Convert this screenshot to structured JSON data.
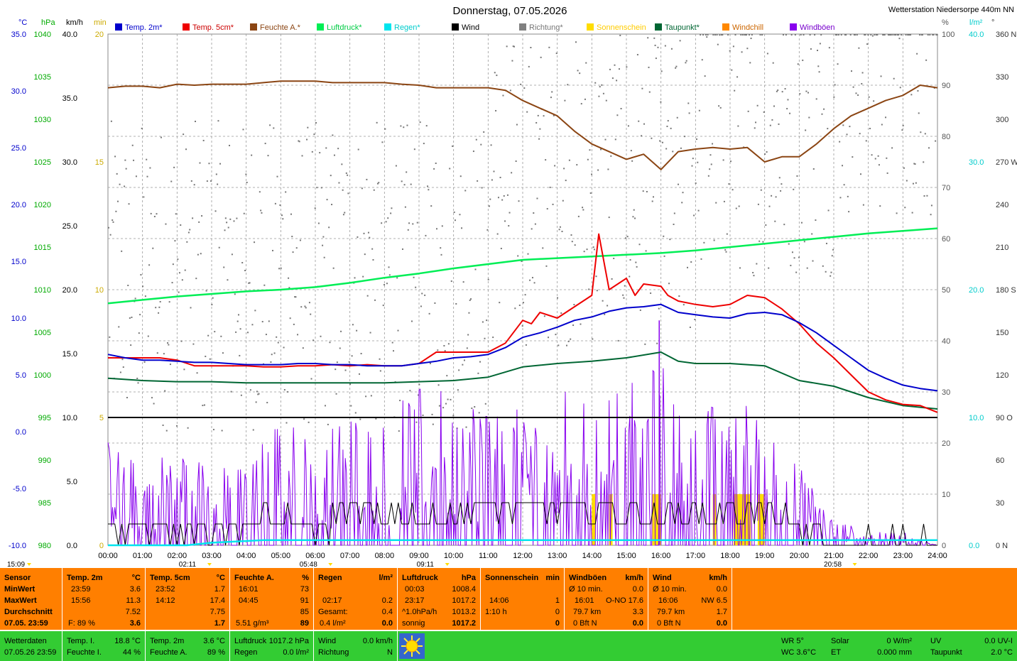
{
  "chart_data": {
    "type": "line",
    "title": "Donnerstag, 07.05.2026",
    "station": "Wetterstation Niedersorpe 440m NN",
    "x_ticks": [
      "00:00",
      "01:00",
      "02:00",
      "03:00",
      "04:00",
      "05:00",
      "06:00",
      "07:00",
      "08:00",
      "09:00",
      "10:00",
      "11:00",
      "12:00",
      "13:00",
      "14:00",
      "15:00",
      "16:00",
      "17:00",
      "18:00",
      "19:00",
      "20:00",
      "21:00",
      "22:00",
      "23:00",
      "24:00"
    ],
    "axes": {
      "temp_c": {
        "unit": "°C",
        "ylim": [
          -10,
          35
        ],
        "ticks": [
          "35.0",
          "30.0",
          "25.0",
          "20.0",
          "15.0",
          "10.0",
          "5.0",
          "0.0",
          "-5.0",
          "-10.0"
        ],
        "color": "#0000cc"
      },
      "pressure_hpa": {
        "unit": "hPa",
        "ylim": [
          980,
          1040
        ],
        "ticks": [
          "1040",
          "1035",
          "1030",
          "1025",
          "1020",
          "1015",
          "1010",
          "1005",
          "1000",
          "995",
          "990",
          "985",
          "980"
        ],
        "color": "#00aa00"
      },
      "wind_kmh": {
        "unit": "km/h",
        "ylim": [
          0,
          40
        ],
        "ticks": [
          "40.0",
          "35.0",
          "30.0",
          "25.0",
          "20.0",
          "15.0",
          "10.0",
          "5.0",
          "0.0"
        ],
        "color": "#000000"
      },
      "sun_min": {
        "unit": "min",
        "ylim": [
          0,
          20
        ],
        "ticks": [
          "20",
          "15",
          "10",
          "5",
          "0"
        ],
        "color": "#ccaa00"
      },
      "humidity_pct": {
        "unit": "%",
        "ylim": [
          0,
          100
        ],
        "ticks": [
          "100",
          "90",
          "80",
          "70",
          "60",
          "50",
          "40",
          "30",
          "20",
          "10",
          "0"
        ],
        "color": "#555555"
      },
      "rain_lm2": {
        "unit": "l/m²",
        "ylim": [
          0,
          40
        ],
        "ticks": [
          "40.0",
          "30.0",
          "20.0",
          "10.0",
          "0.0"
        ],
        "color": "#00cccc"
      },
      "direction_deg": {
        "unit": "°",
        "ylim": [
          0,
          360
        ],
        "ticks": [
          "360 N",
          "330",
          "300",
          "270 W",
          "240",
          "210",
          "180 S",
          "150",
          "120",
          "90 O",
          "60",
          "30",
          "0 N"
        ],
        "color": "#333333"
      }
    },
    "legend": [
      {
        "name": "Temp. 2m*",
        "color": "#0000cc"
      },
      {
        "name": "Temp. 5cm*",
        "color": "#ee0000"
      },
      {
        "name": "Feuchte A.*",
        "color": "#8b4513"
      },
      {
        "name": "Luftdruck*",
        "color": "#00ee55"
      },
      {
        "name": "Regen*",
        "color": "#00e5ee"
      },
      {
        "name": "Wind",
        "color": "#000000"
      },
      {
        "name": "Richtung*",
        "color": "#808080"
      },
      {
        "name": "Sonnenschein",
        "color": "#ffdd00"
      },
      {
        "name": "Taupunkt*",
        "color": "#006633"
      },
      {
        "name": "Windchill",
        "color": "#ff8800"
      },
      {
        "name": "Windböen",
        "color": "#8800ee"
      }
    ],
    "series": [
      {
        "name": "Temp. 2m*",
        "axis": "temp_c",
        "x": [
          0,
          0.5,
          1,
          1.5,
          2,
          2.5,
          3,
          3.5,
          4,
          4.5,
          5,
          5.5,
          6,
          6.5,
          7,
          7.5,
          8,
          8.5,
          9,
          9.5,
          10,
          10.5,
          11,
          11.5,
          12,
          12.5,
          13,
          13.5,
          14,
          14.5,
          15,
          15.5,
          16,
          16.5,
          17,
          17.5,
          18,
          18.5,
          19,
          19.5,
          20,
          20.5,
          21,
          21.5,
          22,
          22.5,
          23,
          23.5,
          24
        ],
        "y": [
          6.8,
          6.5,
          6.3,
          6.3,
          6.2,
          6.1,
          6.1,
          6.0,
          5.9,
          5.9,
          5.9,
          6.0,
          6.0,
          5.9,
          5.9,
          5.8,
          5.8,
          5.8,
          6.0,
          6.2,
          6.5,
          6.6,
          6.8,
          7.4,
          8.3,
          8.7,
          9.2,
          9.8,
          10.1,
          10.6,
          10.9,
          11.0,
          11.2,
          10.5,
          10.3,
          10.1,
          10.0,
          10.4,
          10.5,
          10.3,
          9.6,
          8.7,
          7.6,
          6.5,
          5.4,
          4.7,
          4.1,
          3.8,
          3.6
        ]
      },
      {
        "name": "Temp. 5cm*",
        "axis": "temp_c",
        "x": [
          0,
          0.5,
          1,
          1.5,
          2,
          2.5,
          3,
          3.5,
          4,
          4.5,
          5,
          5.5,
          6,
          6.5,
          7,
          7.5,
          8,
          8.5,
          9,
          9.5,
          10,
          10.5,
          11,
          11.5,
          12,
          12.25,
          12.5,
          13,
          13.5,
          14,
          14.2,
          14.5,
          15,
          15.25,
          15.5,
          16,
          16.2,
          16.5,
          17,
          17.5,
          18,
          18.5,
          19,
          19.5,
          20,
          20.5,
          21,
          21.5,
          22,
          22.5,
          23,
          23.5,
          24
        ],
        "y": [
          6.5,
          6.5,
          6.5,
          6.5,
          6.3,
          5.8,
          5.8,
          5.8,
          5.8,
          5.7,
          5.7,
          5.8,
          5.8,
          5.9,
          5.8,
          5.9,
          5.8,
          5.8,
          6.0,
          7.0,
          7.0,
          7.0,
          7.0,
          7.8,
          9.8,
          9.5,
          10.5,
          10.0,
          11.0,
          12.0,
          17.4,
          12.5,
          13.5,
          12.0,
          13.0,
          12.8,
          12.0,
          11.5,
          11.2,
          11.0,
          11.2,
          12.0,
          11.8,
          10.8,
          9.5,
          7.8,
          6.5,
          5.0,
          3.5,
          2.8,
          2.4,
          2.3,
          1.7
        ]
      },
      {
        "name": "Feuchte A.*",
        "axis": "humidity_pct",
        "x": [
          0,
          0.5,
          1,
          1.5,
          2,
          2.5,
          3,
          3.5,
          4,
          4.5,
          5,
          5.5,
          6,
          6.5,
          7,
          7.5,
          8,
          8.5,
          9,
          9.5,
          10,
          10.5,
          11,
          11.5,
          12,
          12.5,
          13,
          13.5,
          14,
          14.5,
          15,
          15.5,
          16,
          16.5,
          17,
          17.5,
          18,
          18.5,
          19,
          19.5,
          20,
          20.5,
          21,
          21.5,
          22,
          22.5,
          23,
          23.5,
          24
        ],
        "y": [
          89.5,
          89.8,
          89.8,
          89.5,
          90.2,
          90.0,
          90.2,
          90.2,
          90.2,
          90.5,
          90.8,
          90.8,
          90.8,
          90.5,
          90.5,
          90.5,
          90.5,
          90.2,
          90.0,
          89.5,
          89.5,
          89.5,
          89.5,
          89.0,
          87.0,
          85.5,
          84.0,
          81.0,
          78.5,
          77.0,
          75.5,
          76.5,
          73.5,
          77.0,
          77.5,
          77.8,
          77.5,
          77.8,
          75.0,
          76.0,
          76.0,
          78.5,
          81.5,
          84.0,
          85.5,
          87.0,
          88.0,
          90.0,
          89.5
        ]
      },
      {
        "name": "Luftdruck*",
        "axis": "pressure_hpa",
        "x": [
          0,
          1,
          2,
          3,
          4,
          5,
          6,
          7,
          8,
          9,
          10,
          11,
          12,
          13,
          14,
          15,
          16,
          17,
          18,
          19,
          20,
          21,
          22,
          23,
          24
        ],
        "y": [
          1008.4,
          1008.8,
          1009.2,
          1009.5,
          1009.8,
          1010.0,
          1010.3,
          1010.8,
          1011.4,
          1011.9,
          1012.5,
          1013.0,
          1013.5,
          1013.7,
          1013.9,
          1014.1,
          1014.3,
          1014.6,
          1015.0,
          1015.4,
          1015.8,
          1016.2,
          1016.6,
          1016.9,
          1017.2
        ]
      },
      {
        "name": "Taupunkt*",
        "axis": "temp_c",
        "x": [
          0,
          1,
          2,
          3,
          4,
          5,
          6,
          7,
          8,
          9,
          10,
          11,
          12,
          13,
          14,
          15,
          16,
          16.5,
          17,
          18,
          19,
          20,
          21,
          22,
          23,
          24
        ],
        "y": [
          4.7,
          4.5,
          4.4,
          4.4,
          4.3,
          4.3,
          4.3,
          4.3,
          4.3,
          4.4,
          4.5,
          4.8,
          5.7,
          6.0,
          6.2,
          6.5,
          7.0,
          6.2,
          6.0,
          6.0,
          5.8,
          4.5,
          4.0,
          3.0,
          2.3,
          2.0
        ]
      },
      {
        "name": "Regen*",
        "axis": "rain_lm2",
        "x": [
          0,
          2.28,
          3.0,
          4.5,
          24
        ],
        "y": [
          0,
          0,
          0.2,
          0.4,
          0.4
        ]
      },
      {
        "name": "Wind",
        "axis": "wind_kmh",
        "x": [
          0,
          1,
          2,
          3,
          4,
          5,
          6,
          7,
          8,
          9,
          10,
          11,
          12,
          13,
          14,
          15,
          16,
          17,
          18,
          19,
          20,
          21,
          22,
          23,
          24
        ],
        "y": [
          1.5,
          1.5,
          1.5,
          1.5,
          1.8,
          2.0,
          1.5,
          2.2,
          2.5,
          2.0,
          2.5,
          3.0,
          3.0,
          3.0,
          3.0,
          2.5,
          2.5,
          2.0,
          3.0,
          2.5,
          1.0,
          0,
          0,
          0,
          0
        ]
      },
      {
        "name": "Windböen",
        "axis": "wind_kmh",
        "x": [
          0,
          1,
          2,
          3,
          4,
          5,
          6,
          7,
          8,
          9,
          10,
          11,
          12,
          13,
          14,
          15,
          16,
          17,
          18,
          19,
          20,
          21,
          22,
          23,
          24
        ],
        "y": [
          4,
          3,
          4,
          3,
          3,
          5,
          4,
          5,
          5,
          6,
          6,
          6,
          5,
          6,
          6,
          6,
          7,
          5,
          6,
          5,
          3,
          1,
          0.5,
          0.5,
          0
        ]
      }
    ],
    "wind_constant_line": 10.0,
    "time_markers": [
      {
        "label": "15:09",
        "x": 0.6
      },
      {
        "label": "02:11",
        "x": 2.3
      },
      {
        "label": "05:48",
        "x": 5.8
      },
      {
        "label": "09:11",
        "x": 9.18
      },
      {
        "label": "20:58",
        "x": 20.97
      }
    ]
  },
  "panel": {
    "sensor": {
      "header": "Sensor",
      "rows": [
        "MinWert",
        "MaxWert",
        "Durchschnitt",
        "07.05. 23:59"
      ]
    },
    "temp2m": {
      "header": "Temp. 2m",
      "unit": "°C",
      "min_time": "23:59",
      "min_val": "3.6",
      "max_time": "15:56",
      "max_val": "11.3",
      "avg": "7.52",
      "cur_label": "F: 89 %",
      "cur": "3.6"
    },
    "temp5cm": {
      "header": "Temp. 5cm",
      "unit": "°C",
      "min_time": "23:52",
      "min_val": "1.7",
      "max_time": "14:12",
      "max_val": "17.4",
      "avg": "7.75",
      "cur": "1.7"
    },
    "humidity": {
      "header": "Feuchte A.",
      "unit": "%",
      "min_time": "16:01",
      "min_val": "73",
      "max_time": "04:45",
      "max_val": "91",
      "avg": "85",
      "cur_label": "5.51 g/m³",
      "cur": "89"
    },
    "rain": {
      "header": "Regen",
      "unit": "l/m²",
      "r2_time": "02:17",
      "r2_val": "0.2",
      "gesamt_label": "Gesamt:",
      "gesamt_val": "0.4",
      "cur_label": "0.4 l/m²",
      "cur": "0.0"
    },
    "pressure": {
      "header": "Luftdruck",
      "unit": "hPa",
      "min_time": "00:03",
      "min_val": "1008.4",
      "max_time": "23:17",
      "max_val": "1017.2",
      "trend_label": "^1.0hPa/h",
      "trend_val": "1013.2",
      "cur_label": "sonnig",
      "cur": "1017.2"
    },
    "sun": {
      "header": "Sonnenschein",
      "unit": "min",
      "max_time": "14:06",
      "max_val": "1",
      "avg_label": "1:10 h",
      "avg_val": "0",
      "cur": "0"
    },
    "gusts": {
      "header": "Windböen",
      "unit": "km/h",
      "r1_label": "Ø 10 min.",
      "r1_val": "0.0",
      "r2_time": "16:01",
      "r2_dir": "O-NO",
      "r2_val": "17.6",
      "r3_label": "79.7 km",
      "r3_val": "3.3",
      "r4_label": "0 Bft N",
      "r4_val": "0.0"
    },
    "wind": {
      "header": "Wind",
      "unit": "km/h",
      "r1_label": "Ø 10 min.",
      "r1_val": "0.0",
      "r2_time": "16:06",
      "r2_val": "NW 6.5",
      "r3_label": "79.7 km",
      "r3_val": "1.7",
      "r4_label": "0 Bft N",
      "r4_val": "0.0"
    }
  },
  "bottom": {
    "title": "Wetterdaten",
    "datetime": "07.05.26 23:59",
    "temp_i_label": "Temp. I.",
    "temp_i": "18.8 °C",
    "feuchte_i_label": "Feuchte I.",
    "feuchte_i": "44 %",
    "temp2m_label": "Temp. 2m",
    "temp2m": "3.6 °C",
    "feuchte_a_label": "Feuchte A.",
    "feuchte_a": "89 %",
    "luftdruck_label": "Luftdruck",
    "luftdruck": "1017.2 hPa",
    "regen_label": "Regen",
    "regen": "0.0 l/m²",
    "wind_label": "Wind",
    "wind": "0.0 km/h",
    "richtung_label": "Richtung",
    "richtung": "N",
    "wr": "WR 5°",
    "wc": "WC 3.6°C",
    "solar_label": "Solar",
    "solar": "0 W/m²",
    "et_label": "ET",
    "et": "0.000 mm",
    "uv_label": "UV",
    "uv": "0.0 UV-I",
    "taupunkt_label": "Taupunkt",
    "taupunkt": "2.0 °C",
    "weather_icon": "sun-icon"
  }
}
